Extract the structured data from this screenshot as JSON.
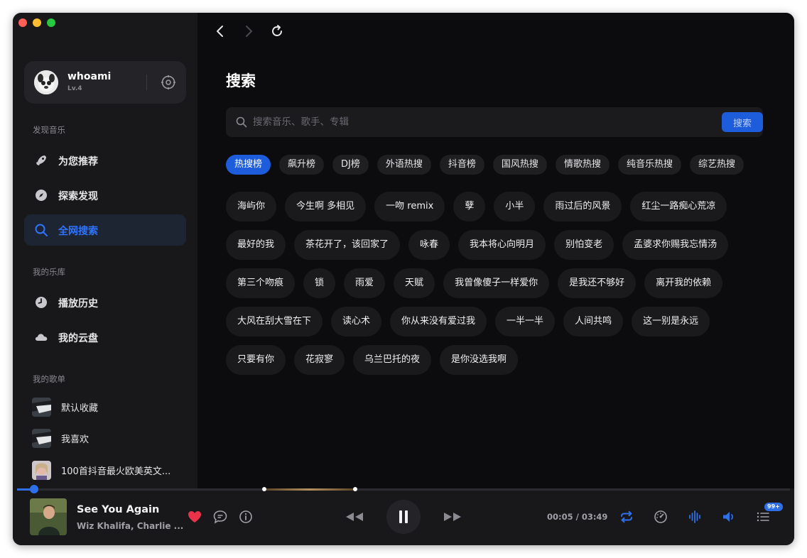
{
  "profile": {
    "name": "whoami",
    "level": "Lv.4"
  },
  "sidebar": {
    "discover_title": "发现音乐",
    "discover_items": [
      {
        "label": "为您推荐",
        "icon": "rocket-icon"
      },
      {
        "label": "探索发现",
        "icon": "compass-icon"
      },
      {
        "label": "全网搜索",
        "icon": "search-icon",
        "active": true
      }
    ],
    "library_title": "我的乐库",
    "library_items": [
      {
        "label": "播放历史",
        "icon": "clock-icon"
      },
      {
        "label": "我的云盘",
        "icon": "cloud-icon"
      }
    ],
    "playlists_title": "我的歌单",
    "playlists": [
      {
        "label": "默认收藏"
      },
      {
        "label": "我喜欢"
      },
      {
        "label": "100首抖音最火欧美英文..."
      }
    ]
  },
  "main": {
    "title": "搜索",
    "search": {
      "placeholder": "搜索音乐、歌手、专辑",
      "value": "",
      "button_label": "搜索"
    },
    "tabs": [
      "热搜榜",
      "飙升榜",
      "DJ榜",
      "外语热搜",
      "抖音榜",
      "国风热搜",
      "情歌热搜",
      "纯音乐热搜",
      "综艺热搜"
    ],
    "active_tab": "热搜榜",
    "hot_searches": [
      "海屿你",
      "今生啊 多相见",
      "一吻 remix",
      "孽",
      "小半",
      "雨过后的风景",
      "红尘一路痴心荒凉",
      "最好的我",
      "茶花开了，该回家了",
      "咏春",
      "我本将心向明月",
      "别怕变老",
      "孟婆求你赐我忘情汤",
      "第三个吻痕",
      "锁",
      "雨爱",
      "天赋",
      "我曾像傻子一样爱你",
      "是我还不够好",
      "离开我的依赖",
      "大风在刮大雪在下",
      "读心术",
      "你从来没有爱过我",
      "一半一半",
      "人间共鸣",
      "这一别是永远",
      "只要有你",
      "花寂寥",
      "乌兰巴托的夜",
      "是你没选我啊"
    ]
  },
  "player": {
    "title": "See You Again",
    "artist": "Wiz Khalifa, Charlie ...",
    "current_time": "00:05",
    "duration": "03:49",
    "time_display": "00:05 / 03:49",
    "progress_fraction": 0.022,
    "queue_badge": "99+",
    "accent_color": "#2f6fe8",
    "like_color": "#e8334a"
  }
}
